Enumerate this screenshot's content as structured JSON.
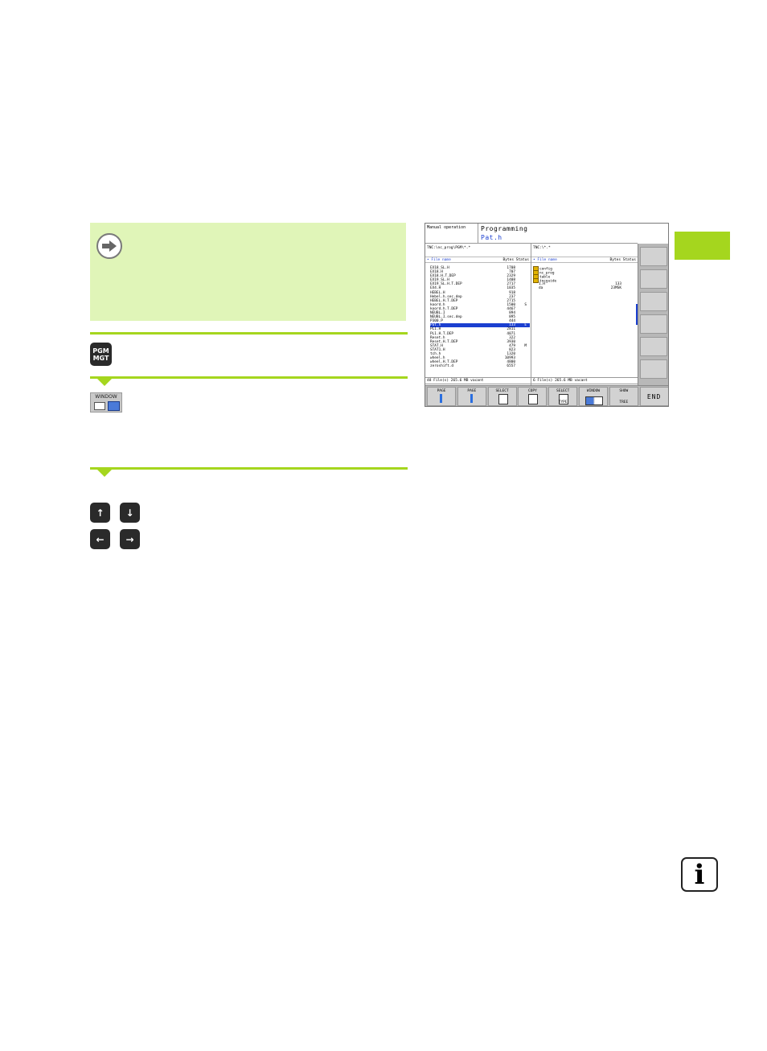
{
  "sidebar": {
    "note_icon": "arrow-right-icon",
    "info_icon": "info-icon"
  },
  "keys": {
    "pgm_line1": "PGM",
    "pgm_line2": "MGT",
    "window_label": "WINDOW",
    "up": "↑",
    "down": "↓",
    "left": "←",
    "right": "→"
  },
  "screen": {
    "mode_left": "Manual operation",
    "mode_right": "Programming",
    "file": "Pat.h",
    "left_path": "TNC:\\nc_prog\\PGM\\*.*",
    "right_path": "TNC:\\*.*",
    "col_name": "• File name",
    "col_status": "Bytes Status",
    "files": [
      {
        "name": "EX18_SL.H",
        "bytes": "1708",
        "status": ""
      },
      {
        "name": "EX18.H",
        "bytes": "707",
        "status": ""
      },
      {
        "name": "EX18.H.T.DEP",
        "bytes": "2329",
        "status": ""
      },
      {
        "name": "EX19_SL.H",
        "bytes": "1408",
        "status": ""
      },
      {
        "name": "EX19_SL.H.T.DEP",
        "bytes": "2717",
        "status": ""
      },
      {
        "name": "EX4.H",
        "bytes": "1035",
        "status": ""
      },
      {
        "name": "HEBEL.H",
        "bytes": "918",
        "status": ""
      },
      {
        "name": "Hebel.h.sec.dep",
        "bytes": "237",
        "status": ""
      },
      {
        "name": "HEBEL.H.T.DEP",
        "bytes": "2715",
        "status": ""
      },
      {
        "name": "koord.h",
        "bytes": "1500",
        "status": "S"
      },
      {
        "name": "koord.h.T.DEP",
        "bytes": "4467",
        "status": ""
      },
      {
        "name": "NEUBL.I",
        "bytes": "894",
        "status": ""
      },
      {
        "name": "NEUBL.I.sec.dep",
        "bytes": "895",
        "status": ""
      },
      {
        "name": "P300.P",
        "bytes": "444",
        "status": ""
      },
      {
        "name": "Pat.h",
        "bytes": "133",
        "status": "E",
        "selected": true
      },
      {
        "name": "PL1.H",
        "bytes": "2811",
        "status": ""
      },
      {
        "name": "PL1.H.T.DEP",
        "bytes": "4071",
        "status": ""
      },
      {
        "name": "Reset.h",
        "bytes": "322",
        "status": ""
      },
      {
        "name": "Reset.H.T.DEP",
        "bytes": "3930",
        "status": ""
      },
      {
        "name": "STAT.H",
        "bytes": "479",
        "status": "M"
      },
      {
        "name": "STAT1.H",
        "bytes": "823",
        "status": ""
      },
      {
        "name": "tch.h",
        "bytes": "1320",
        "status": ""
      },
      {
        "name": "wheel.h",
        "bytes": "10993",
        "status": ""
      },
      {
        "name": "wheel.H.T.DEP",
        "bytes": "4800",
        "status": ""
      },
      {
        "name": "zeroshift.d",
        "bytes": "6557",
        "status": ""
      }
    ],
    "dirs": [
      {
        "name": "config",
        "bytes": "",
        "folder": true
      },
      {
        "name": "nc_prog",
        "bytes": "",
        "folder": true
      },
      {
        "name": "table",
        "bytes": "",
        "folder": true
      },
      {
        "name": "tncguide",
        "bytes": "",
        "folder": true
      },
      {
        "name": "1.H",
        "bytes": "133",
        "folder": false
      },
      {
        "name": "da",
        "bytes": "23MSK",
        "folder": false
      }
    ],
    "left_footer": "48  File(s)  265.6 MB vacant",
    "right_footer": "6   File(s)  265.6 MB vacant",
    "softkeys": [
      {
        "l1": "PAGE",
        "l2": ""
      },
      {
        "l1": "PAGE",
        "l2": ""
      },
      {
        "l1": "SELECT",
        "l2": ""
      },
      {
        "l1": "COPY",
        "l2": ""
      },
      {
        "l1": "SELECT",
        "l2": "TYPE"
      },
      {
        "l1": "WINDOW",
        "l2": ""
      },
      {
        "l1": "SHOW",
        "l2": "TREE"
      },
      {
        "l1": "END",
        "l2": ""
      }
    ]
  },
  "colors": {
    "accent": "#a5d61e",
    "note_bg": "#e0f5b8",
    "highlight": "#1b3fd0"
  }
}
